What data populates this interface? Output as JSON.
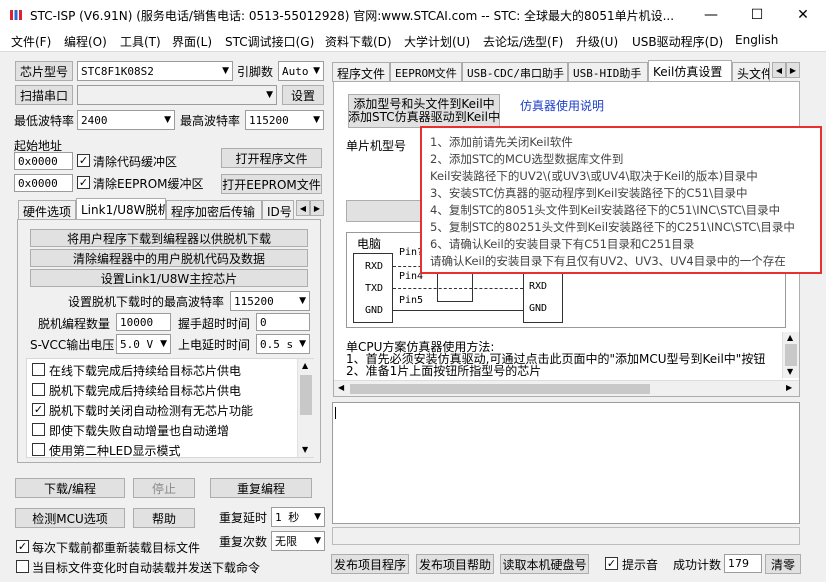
{
  "window": {
    "title": "STC-ISP (V6.91N) (服务电话/销售电话: 0513-55012928) 官网:www.STCAI.com  -- STC: 全球最大的8051单片机设...",
    "controls": [
      "—",
      "☐",
      "✕"
    ]
  },
  "menu": [
    "文件(F)",
    "编程(O)",
    "工具(T)",
    "界面(L)",
    "STC调试接口(G)",
    "资料下载(D)",
    "大学计划(U)",
    "去论坛/选型(F)",
    "升级(U)",
    "USB驱动程序(D)",
    "English"
  ],
  "left": {
    "chip_type_button": "芯片型号",
    "chip_type_value": "STC8F1K08S2",
    "pin_count_label": "引脚数",
    "pin_count_value": "Auto",
    "scan_port_button": "扫描串口",
    "port_value": "",
    "settings_button": "设置",
    "min_baud_label": "最低波特率",
    "min_baud_value": "2400",
    "max_baud_label": "最高波特率",
    "max_baud_value": "115200",
    "start_addr_label": "起始地址",
    "addr1_value": "0x0000",
    "clear_code_label": "清除代码缓冲区",
    "open_program_button": "打开程序文件",
    "addr2_value": "0x0000",
    "clear_eeprom_label": "清除EEPROM缓冲区",
    "open_eeprom_button": "打开EEPROM文件",
    "tabs": [
      "硬件选项",
      "Link1/U8W脱机",
      "程序加密后传输",
      "ID号"
    ],
    "offline": {
      "btn1": "将用户程序下载到编程器以供脱机下载",
      "btn2": "清除编程器中的用户脱机代码及数据",
      "btn3": "设置Link1/U8W主控芯片",
      "max_baud_label": "设置脱机下载时的最高波特率",
      "max_baud_value": "115200",
      "count_label": "脱机编程数量",
      "count_value": "10000",
      "timeout_label": "握手超时时间",
      "timeout_value": "0",
      "svcc_label": "S-VCC输出电压",
      "svcc_value": "5.0 V",
      "delay_label": "上电延时时间",
      "delay_value": "0.5 s",
      "options": [
        {
          "label": "在线下载完成后持续给目标芯片供电",
          "checked": false
        },
        {
          "label": "脱机下载完成后持续给目标芯片供电",
          "checked": false
        },
        {
          "label": "脱机下载时关闭自动检测有无芯片功能",
          "checked": true
        },
        {
          "label": "即使下载失败自动增量也自动递增",
          "checked": false
        },
        {
          "label": "使用第二种LED显示模式",
          "checked": false
        }
      ]
    },
    "download_button": "下载/编程",
    "stop_button": "停止",
    "reprogram_button": "重复编程",
    "detect_button": "检测MCU选项",
    "help_button": "帮助",
    "repeat_delay_label": "重复延时",
    "repeat_delay_value": "1 秒",
    "repeat_count_label": "重复次数",
    "repeat_count_value": "无限",
    "reload_label": "每次下载前都重新装载目标文件",
    "auto_load_label": "当目标文件变化时自动装载并发送下载命令"
  },
  "right": {
    "tabs": [
      "程序文件",
      "EEPROM文件",
      "USB-CDC/串口助手",
      "USB-HID助手",
      "Keil仿真设置",
      "头文件"
    ],
    "add_keil_button": "添加型号和头文件到Keil中\n添加STC仿真器驱动到Keil中",
    "add_keil_line1": "添加型号和头文件到Keil中",
    "add_keil_line2": "添加STC仿真器驱动到Keil中",
    "emulator_doc_link": "仿真器使用说明",
    "chip_label": "单片机型号",
    "diagram": {
      "pc_label": "电脑",
      "rxd": "RXD",
      "txd": "TXD",
      "gnd": "GND",
      "pin1": "Pin?",
      "pin2": "Pin4",
      "pin5": "Pin5",
      "rxd2": "RXD",
      "gnd2": "GND"
    },
    "method_title": "单CPU方案仿真器使用方法:",
    "method_line1": "1、首先必须安装仿真驱动,可通过点击此页面中的\"添加MCU型号到Keil中\"按钮进",
    "method_line2": "2、准备1片上面按钮所指型号的芯片",
    "tooltip": [
      "1、添加前请先关闭Keil软件",
      "2、添加STC的MCU选型数据库文件到",
      "      Keil安装路径下的UV2\\(或UV3\\或UV4\\取决于Keil的版本)目录中",
      "3、安装STC仿真器的驱动程序到Keil安装路径下的C51\\目录中",
      "4、复制STC的8051头文件到Keil安装路径下的C51\\INC\\STC\\目录中",
      "5、复制STC的80251头文件到Keil安装路径下的C251\\INC\\STC\\目录中",
      "6、请确认Keil的安装目录下有C51目录和C251目录",
      "      请确认Keil的安装目录下有且仅有UV2、UV3、UV4目录中的一个存在"
    ],
    "log_text": "",
    "publish_button": "发布项目程序",
    "publish_help_button": "发布项目帮助",
    "read_sn_button": "读取本机硬盘号",
    "beep_label": "提示音",
    "success_count_label": "成功计数",
    "success_count_value": "179",
    "clear_button": "清零"
  }
}
